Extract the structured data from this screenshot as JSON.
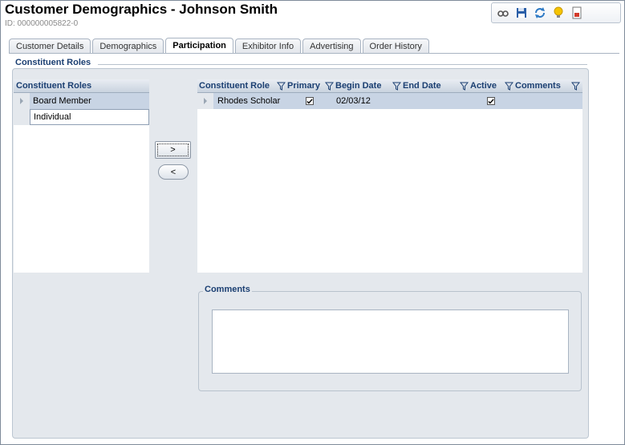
{
  "header": {
    "title": "Customer Demographics - Johnson Smith",
    "id_line": "ID: 000000005822-0"
  },
  "toolbar": {
    "icons": [
      "view-icon",
      "save-icon",
      "refresh-icon",
      "lightbulb-icon",
      "report-icon"
    ]
  },
  "tabs": [
    {
      "label": "Customer Details",
      "active": false
    },
    {
      "label": "Demographics",
      "active": false
    },
    {
      "label": "Participation",
      "active": true
    },
    {
      "label": "Exhibitor Info",
      "active": false
    },
    {
      "label": "Advertising",
      "active": false
    },
    {
      "label": "Order History",
      "active": false
    }
  ],
  "group": {
    "label": "Constituent Roles"
  },
  "available_roles": {
    "header": "Constituent Roles",
    "items": [
      "Board Member",
      "Individual"
    ]
  },
  "buttons": {
    "add": ">",
    "remove": "<"
  },
  "grid": {
    "columns": [
      "Constituent Role",
      "Primary",
      "Begin Date",
      "End Date",
      "Active",
      "Comments"
    ],
    "rows": [
      {
        "role": "Rhodes Scholar",
        "primary": true,
        "begin_date": "02/03/12",
        "end_date": "",
        "active": true,
        "comments": ""
      }
    ]
  },
  "comments": {
    "label": "Comments",
    "value": ""
  },
  "colors": {
    "accent_text": "#1b3f72",
    "selected_row": "#c8d4e4",
    "panel_bg": "#e4e8ed"
  }
}
